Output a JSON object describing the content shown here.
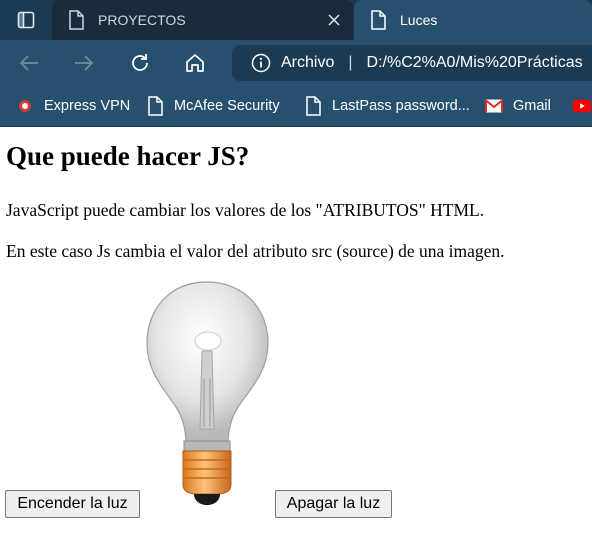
{
  "browser": {
    "tabs": [
      {
        "label": "PROYECTOS",
        "active": false
      },
      {
        "label": "Luces",
        "active": true
      }
    ],
    "address": {
      "scheme_label": "Archivo",
      "separator": "|",
      "url": "D:/%C2%A0/Mis%20Prácticas"
    },
    "bookmarks": [
      {
        "label": "Express VPN",
        "icon": "expressvpn-icon"
      },
      {
        "label": "McAfee Security",
        "icon": "page-icon"
      },
      {
        "label": "LastPass password...",
        "icon": "page-icon"
      },
      {
        "label": "Gmail",
        "icon": "gmail-icon"
      }
    ]
  },
  "page": {
    "heading": "Que puede hacer JS?",
    "paragraph1": "JavaScript puede cambiar los valores de los \"ATRIBUTOS\" HTML.",
    "paragraph2": "En este caso Js cambia el valor del atributo src (source) de una imagen.",
    "button_on": "Encender la luz",
    "button_off": "Apagar la luz",
    "bulb_state": "off"
  },
  "colors": {
    "tabstrip": "#1c3b52",
    "toolbar": "#27506e",
    "bulb_base": "#f5a54a"
  }
}
